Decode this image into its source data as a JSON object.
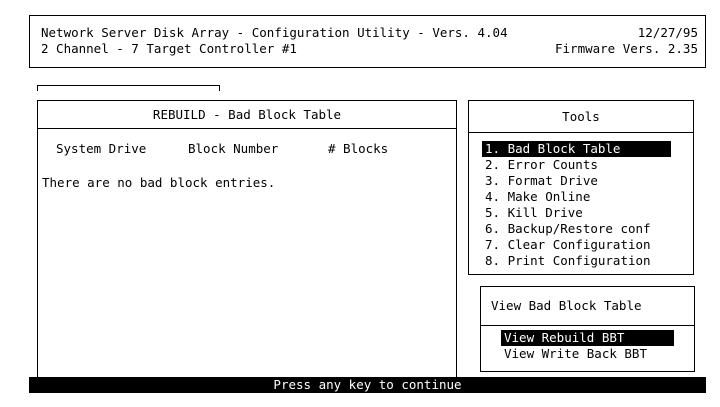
{
  "header": {
    "line1_left": "Network Server Disk Array - Configuration Utility - Vers. 4.04",
    "line1_right": "12/27/95",
    "line2_left": "2 Channel - 7 Target Controller #1",
    "line2_right": "Firmware Vers. 2.35"
  },
  "main_panel": {
    "title": "REBUILD - Bad Block Table",
    "columns": [
      "System Drive",
      "Block Number",
      "# Blocks"
    ],
    "message": "There are no bad block entries."
  },
  "tools": {
    "title": "Tools",
    "items": [
      "1. Bad Block Table",
      "2. Error Counts",
      "3. Format Drive",
      "4. Make Online",
      "5. Kill Drive",
      "6. Backup/Restore conf",
      "7. Clear Configuration",
      "8. Print Configuration"
    ]
  },
  "view_bbt": {
    "title": "View Bad Block Table",
    "items": [
      "View Rebuild BBT",
      "View Write Back BBT"
    ]
  },
  "status": "Press any key to continue"
}
